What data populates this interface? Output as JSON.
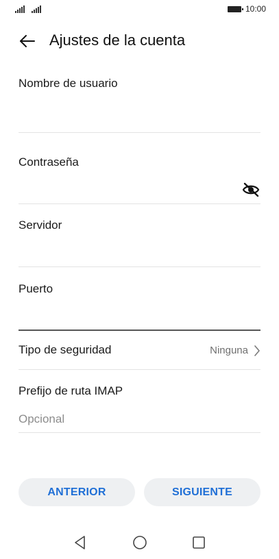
{
  "status_bar": {
    "time": "10:00",
    "icons": [
      "signal-icon",
      "signal-icon",
      "battery-icon"
    ]
  },
  "header": {
    "title": "Ajustes de la cuenta",
    "back_icon": "arrow-left-icon"
  },
  "form": {
    "username": {
      "label": "Nombre de usuario",
      "value": ""
    },
    "password": {
      "label": "Contraseña",
      "value": "",
      "toggle_icon": "eye-off-icon"
    },
    "server": {
      "label": "Servidor",
      "value": ""
    },
    "port": {
      "label": "Puerto",
      "value": ""
    },
    "security_type": {
      "label": "Tipo de seguridad",
      "value": "Ninguna",
      "icon": "chevron-right-icon"
    },
    "imap_prefix": {
      "label": "Prefijo de ruta IMAP",
      "placeholder": "Opcional",
      "value": ""
    }
  },
  "buttons": {
    "previous": "ANTERIOR",
    "next": "SIGUIENTE"
  },
  "nav_bar": {
    "icons": [
      "nav-back-icon",
      "nav-home-icon",
      "nav-recent-apps-icon"
    ]
  },
  "colors": {
    "accent": "#1f6fd6",
    "button_bg": "#eef0f2",
    "divider": "#e3e3e3",
    "placeholder": "#8c8c8c"
  }
}
